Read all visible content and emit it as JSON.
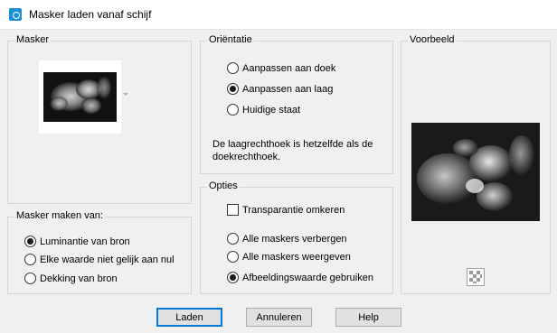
{
  "window": {
    "title": "Masker laden vanaf schijf"
  },
  "mask_group": {
    "label": "Masker"
  },
  "orientation": {
    "label": "Oriëntatie",
    "options": [
      {
        "label": "Aanpassen aan doek",
        "selected": false
      },
      {
        "label": "Aanpassen aan laag",
        "selected": true
      },
      {
        "label": "Huidige staat",
        "selected": false
      }
    ],
    "info": "De laagrechthoek is hetzelfde als de doekrechthoek."
  },
  "preview": {
    "label": "Voorbeeld",
    "checker_icon": "transparency-checker-icon"
  },
  "mask_source": {
    "label": "Masker maken van:",
    "options": [
      {
        "label": "Luminantie van bron",
        "selected": true
      },
      {
        "label": "Elke waarde niet gelijk aan nul",
        "selected": false
      },
      {
        "label": "Dekking van bron",
        "selected": false
      }
    ]
  },
  "options": {
    "label": "Opties",
    "invert": {
      "label": "Transparantie omkeren",
      "checked": false
    },
    "radios": [
      {
        "label": "Alle maskers verbergen",
        "selected": false
      },
      {
        "label": "Alle maskers weergeven",
        "selected": false
      },
      {
        "label": "Afbeeldingswaarde gebruiken",
        "selected": true
      }
    ]
  },
  "buttons": {
    "load": "Laden",
    "cancel": "Annuleren",
    "help": "Help"
  }
}
